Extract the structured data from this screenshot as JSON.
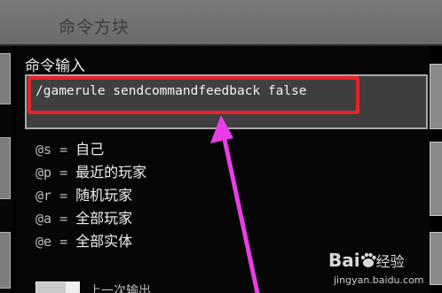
{
  "window": {
    "title": "命令方块"
  },
  "command": {
    "label": "命令输入",
    "value": "/gamerule sendcommandfeedback false",
    "highlight_color": "#e8222c"
  },
  "selectors": [
    {
      "key": "@s",
      "sep": " = ",
      "desc": "自己"
    },
    {
      "key": "@p",
      "sep": " = ",
      "desc": "最近的玩家"
    },
    {
      "key": "@r",
      "sep": " = ",
      "desc": "随机玩家"
    },
    {
      "key": "@a",
      "sep": " = ",
      "desc": "全部玩家"
    },
    {
      "key": "@e",
      "sep": " = ",
      "desc": "全部实体"
    }
  ],
  "bottom": {
    "partial_text": "上一次输出"
  },
  "annotation": {
    "arrow_color": "#e83ee8"
  },
  "watermark": {
    "brand_left": "Bai",
    "brand_right": "经验",
    "url": "jingyan.baidu.com"
  }
}
